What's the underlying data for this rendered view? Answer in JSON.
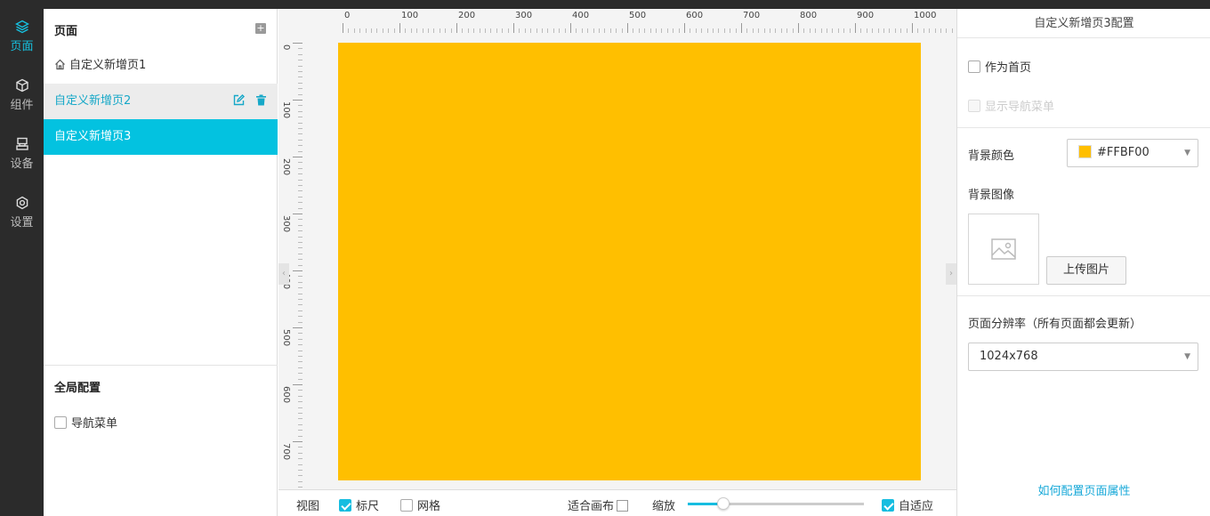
{
  "nav": [
    {
      "label": "页面",
      "icon": "layers-icon",
      "active": true
    },
    {
      "label": "组件",
      "icon": "cube-icon",
      "active": false
    },
    {
      "label": "设备",
      "icon": "device-icon",
      "active": false
    },
    {
      "label": "设置",
      "icon": "gear-icon",
      "active": false
    }
  ],
  "pages_panel": {
    "title": "页面",
    "add_icon": "plus-square-icon",
    "items": [
      {
        "label": "自定义新增页1",
        "is_home": true
      },
      {
        "label": "自定义新增页2",
        "state": "hover"
      },
      {
        "label": "自定义新增页3",
        "state": "selected"
      }
    ],
    "global": {
      "title": "全局配置",
      "nav_menu_label": "导航菜单"
    }
  },
  "canvas": {
    "background": "#FFBF00",
    "ruler_top_labels": [
      "0",
      "100",
      "200",
      "300",
      "400",
      "500",
      "600",
      "700",
      "800",
      "900",
      "1000"
    ],
    "ruler_left_labels": [
      "0",
      "100",
      "200",
      "300",
      "400",
      "500",
      "600",
      "700"
    ]
  },
  "bottombar": {
    "view_label": "视图",
    "ruler_label": "标尺",
    "ruler_checked": true,
    "grid_label": "网格",
    "grid_checked": false,
    "fit_label": "适合画布",
    "zoom_label": "缩放",
    "zoom_fraction": 0.2,
    "auto_label": "自适应",
    "auto_checked": true
  },
  "config": {
    "title": "自定义新增页3配置",
    "as_home_label": "作为首页",
    "show_nav_label": "显示导航菜单",
    "bg_color_label": "背景颜色",
    "bg_color_value": "#FFBF00",
    "bg_image_label": "背景图像",
    "upload_label": "上传图片",
    "resolution_label": "页面分辨率（所有页面都会更新）",
    "resolution_value": "1024x768",
    "help_link": "如何配置页面属性"
  },
  "colors": {
    "accent": "#03C2E0",
    "dark_nav": "#2B2B2B"
  }
}
